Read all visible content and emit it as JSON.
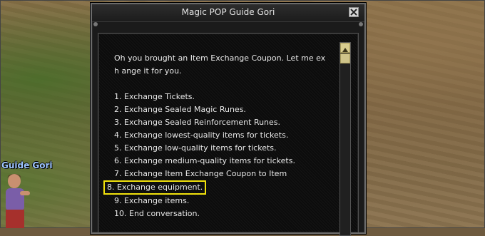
{
  "world": {
    "npc_name": "Guide Gori"
  },
  "dialog": {
    "title": "Magic POP Guide Gori",
    "intro": "Oh you brought an Item Exchange Coupon. Let me exh ange it for you.",
    "options": [
      "1. Exchange Tickets.",
      "2. Exchange Sealed Magic Runes.",
      "3. Exchange Sealed Reinforcement Runes.",
      "4. Exchange lowest-quality items for tickets.",
      "5. Exchange low-quality items for tickets.",
      "6. Exchange medium-quality items for tickets.",
      "7. Exchange Item Exchange Coupon to Item",
      "8. Exchange equipment.",
      "9. Exchange items.",
      "10. End conversation."
    ],
    "highlighted_option_index": 7,
    "highlight_color": "#f2e20c"
  },
  "icons": {
    "close": "close-icon",
    "scroll_up": "scroll-up-arrow-icon"
  }
}
